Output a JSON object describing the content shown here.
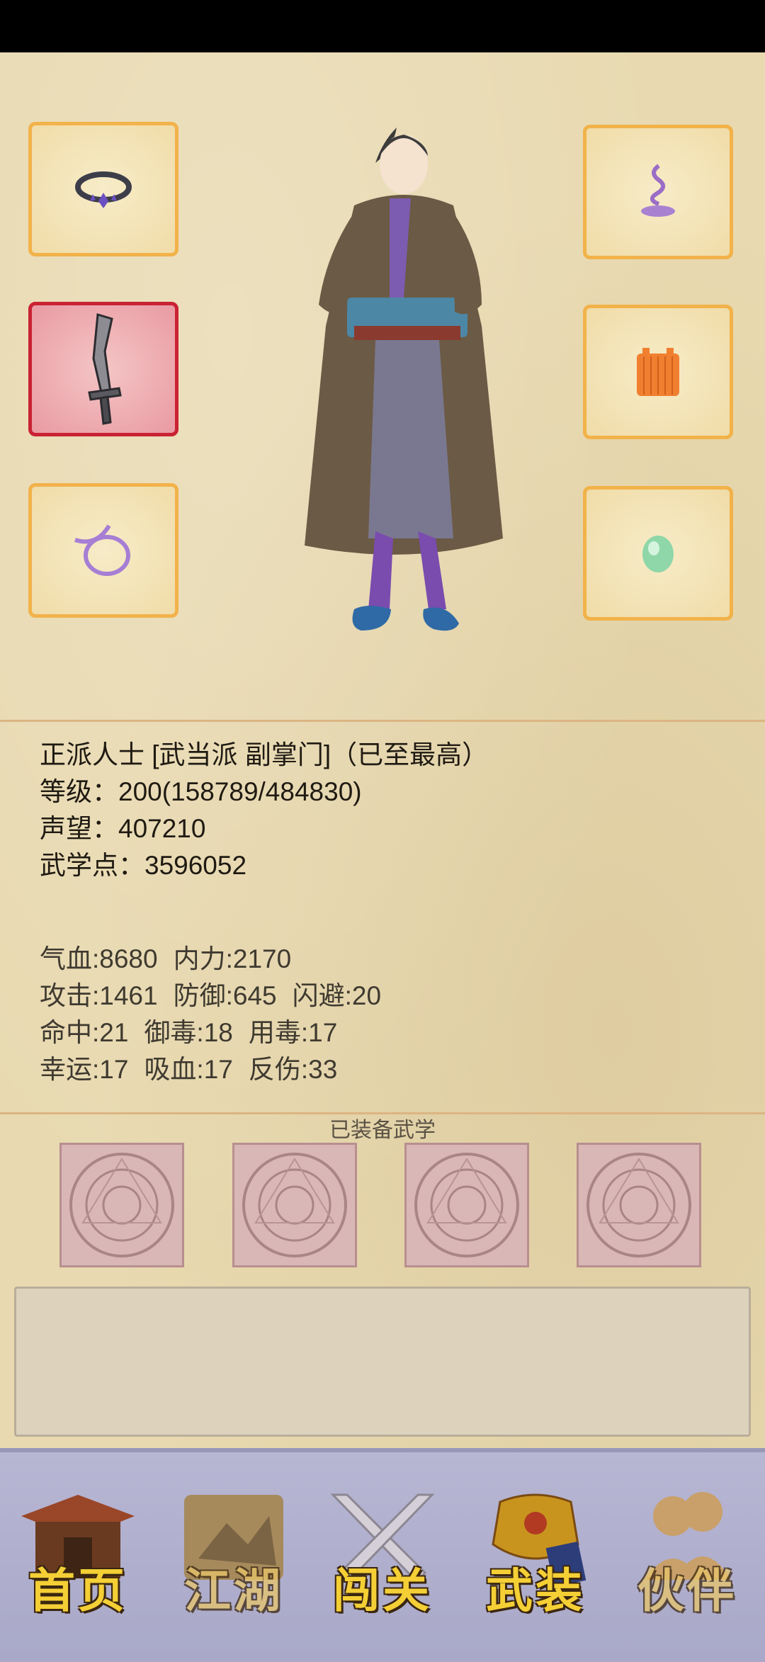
{
  "equipment": {
    "left_slots": [
      "ring-icon",
      "blade-icon",
      "lasso-icon"
    ],
    "right_slots": [
      "incense-icon",
      "robe-icon",
      "jade-icon"
    ],
    "active_slot": "blade-icon"
  },
  "profile": {
    "line1": "正派人士 [武当派 副掌门]（已至最高）",
    "level": "等级：200(158789/484830)",
    "prestige": "声望：407210",
    "martial_points": "武学点：3596052"
  },
  "stats": {
    "hp": "气血:8680",
    "internal": "内力:2170",
    "attack": "攻击:1461",
    "defense": "防御:645",
    "dodge": "闪避:20",
    "hit": "命中:21",
    "poison_resist": "御毒:18",
    "poison_use": "用毒:17",
    "luck": "幸运:17",
    "lifesteal": "吸血:17",
    "reflect": "反伤:33"
  },
  "skills": {
    "label": "已装备武学",
    "slots": [
      "empty-skill-slot",
      "empty-skill-slot",
      "empty-skill-slot",
      "empty-skill-slot"
    ]
  },
  "nav": [
    {
      "label": "首页",
      "icon": "pavilion-icon"
    },
    {
      "label": "江湖",
      "icon": "scroll-map-icon"
    },
    {
      "label": "闯关",
      "icon": "crossed-swords-icon"
    },
    {
      "label": "武装",
      "icon": "armor-icon"
    },
    {
      "label": "伙伴",
      "icon": "companions-icon"
    }
  ],
  "colors": {
    "slot_border": "#f2b24a",
    "active_slot_border": "#c92233",
    "nav_text": "#f4cf35",
    "parchment": "#e8d9b0"
  }
}
